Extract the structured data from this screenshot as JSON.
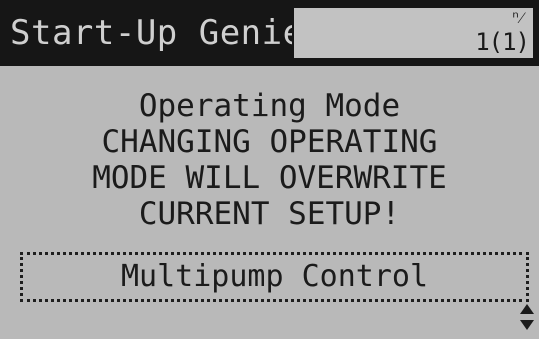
{
  "header": {
    "title": "Start-Up Genie",
    "page_indicator": "1(1)",
    "tab_icon": "ⁿ⁄"
  },
  "message": {
    "lines": [
      "Operating Mode",
      "CHANGING OPERATING",
      "MODE WILL OVERWRITE",
      "CURRENT SETUP!"
    ]
  },
  "selector": {
    "value": "Multipump Control"
  },
  "icons": {
    "scroll": "up-down-arrows-icon"
  },
  "colors": {
    "lcd_background": "#b9b9b9",
    "lcd_dark": "#161616"
  }
}
